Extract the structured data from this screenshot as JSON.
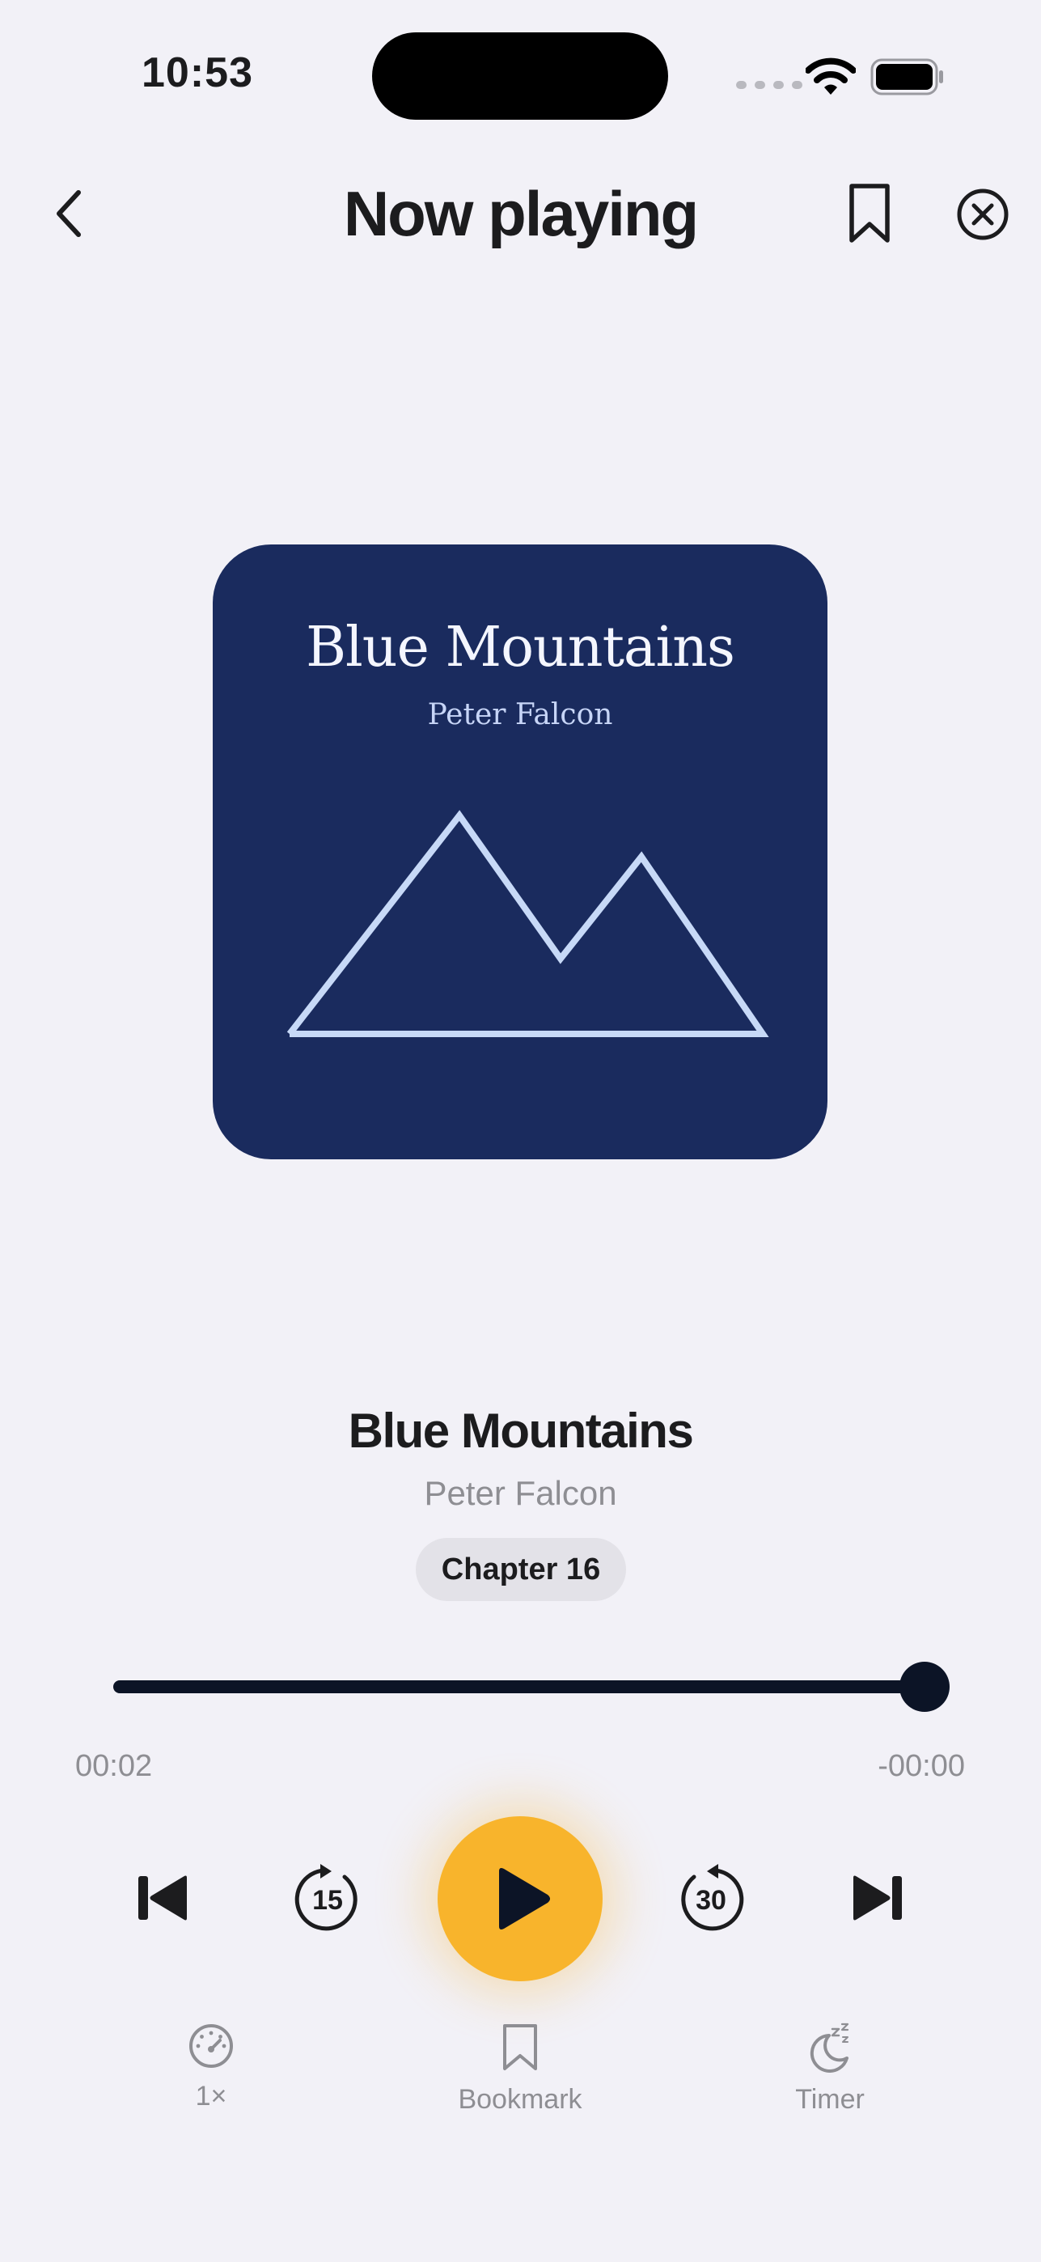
{
  "status_bar": {
    "time": "10:53"
  },
  "header": {
    "title": "Now playing"
  },
  "cover": {
    "title": "Blue Mountains",
    "author": "Peter Falcon",
    "background_color": "#1a2b5e",
    "line_color": "#c7d9f7"
  },
  "book": {
    "title": "Blue Mountains",
    "author": "Peter Falcon",
    "chapter": "Chapter 16"
  },
  "progress": {
    "elapsed": "00:02",
    "remaining": "-00:00",
    "fraction": 0.997
  },
  "controls": {
    "rewind_seconds": "15",
    "forward_seconds": "30",
    "play_color": "#f8b42c"
  },
  "bottom_bar": {
    "speed_label": "1×",
    "bookmark_label": "Bookmark",
    "timer_label": "Timer"
  },
  "icons": {
    "back": "chevron-left-icon",
    "header_bookmark": "bookmark-icon",
    "close": "close-circle-icon",
    "prev": "skip-previous-icon",
    "rewind": "rewind-15-icon",
    "play": "play-icon",
    "forward": "forward-30-icon",
    "next": "skip-next-icon",
    "speed": "speedometer-icon",
    "timer": "moon-zzz-icon"
  }
}
